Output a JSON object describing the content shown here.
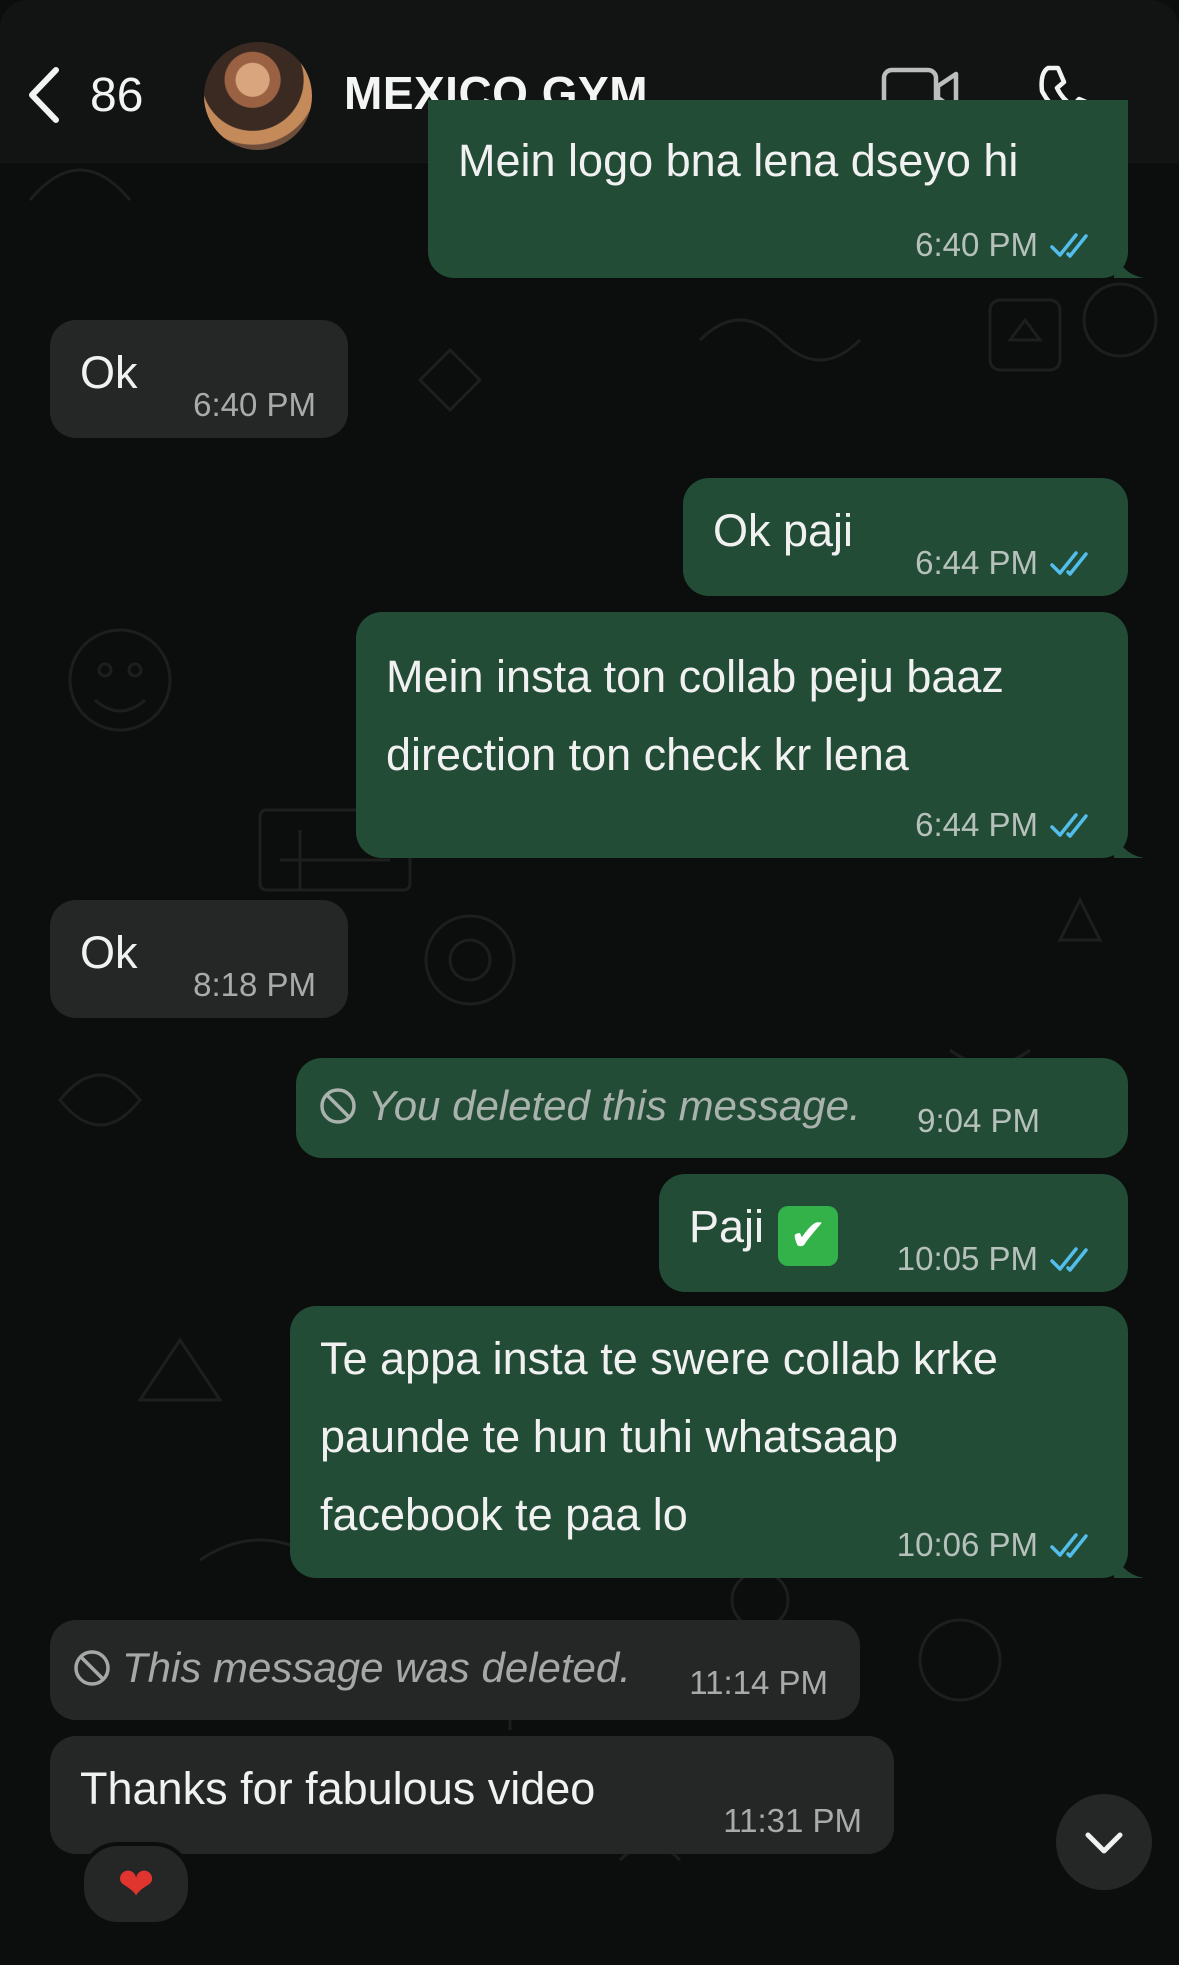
{
  "header": {
    "back_count": "86",
    "contact_name": "MEXICO GYM"
  },
  "messages": [
    {
      "direction": "out",
      "text": "Mein logo bna lena dseyo hi",
      "time": "6:40 PM",
      "status": "read"
    },
    {
      "direction": "in",
      "text": "Ok",
      "time": "6:40 PM"
    },
    {
      "direction": "out",
      "text": "Ok paji",
      "time": "6:44 PM",
      "status": "read"
    },
    {
      "direction": "out",
      "lines": [
        "Mein insta ton collab peju baaz",
        "direction ton check kr lena"
      ],
      "time": "6:44 PM",
      "status": "read"
    },
    {
      "direction": "in",
      "text": "Ok",
      "time": "8:18 PM"
    },
    {
      "direction": "out",
      "deleted": true,
      "text": "You deleted this message.",
      "time": "9:04 PM"
    },
    {
      "direction": "out",
      "text": "Paji",
      "emoji": "✔",
      "time": "10:05 PM",
      "status": "read"
    },
    {
      "direction": "out",
      "lines": [
        "Te appa insta te swere collab krke",
        "paunde te hun tuhi whatsaap",
        "facebook te paa lo"
      ],
      "time": "10:06 PM",
      "status": "read"
    },
    {
      "direction": "in",
      "deleted": true,
      "text": "This message was deleted.",
      "time": "11:14 PM"
    },
    {
      "direction": "in",
      "text": "Thanks for fabulous video",
      "time": "11:31 PM",
      "reaction": "❤"
    }
  ],
  "icons": {
    "back": "chevron-left-icon",
    "video": "video-camera-icon",
    "call": "phone-icon",
    "read": "double-check-icon",
    "deleted": "ban-icon",
    "scroll": "chevron-down-icon",
    "reaction": "heart-icon"
  },
  "colors": {
    "outgoing_bubble": "#234c37",
    "incoming_bubble": "#252727",
    "read_ticks": "#53bdeb",
    "background": "#0c0d0d"
  }
}
